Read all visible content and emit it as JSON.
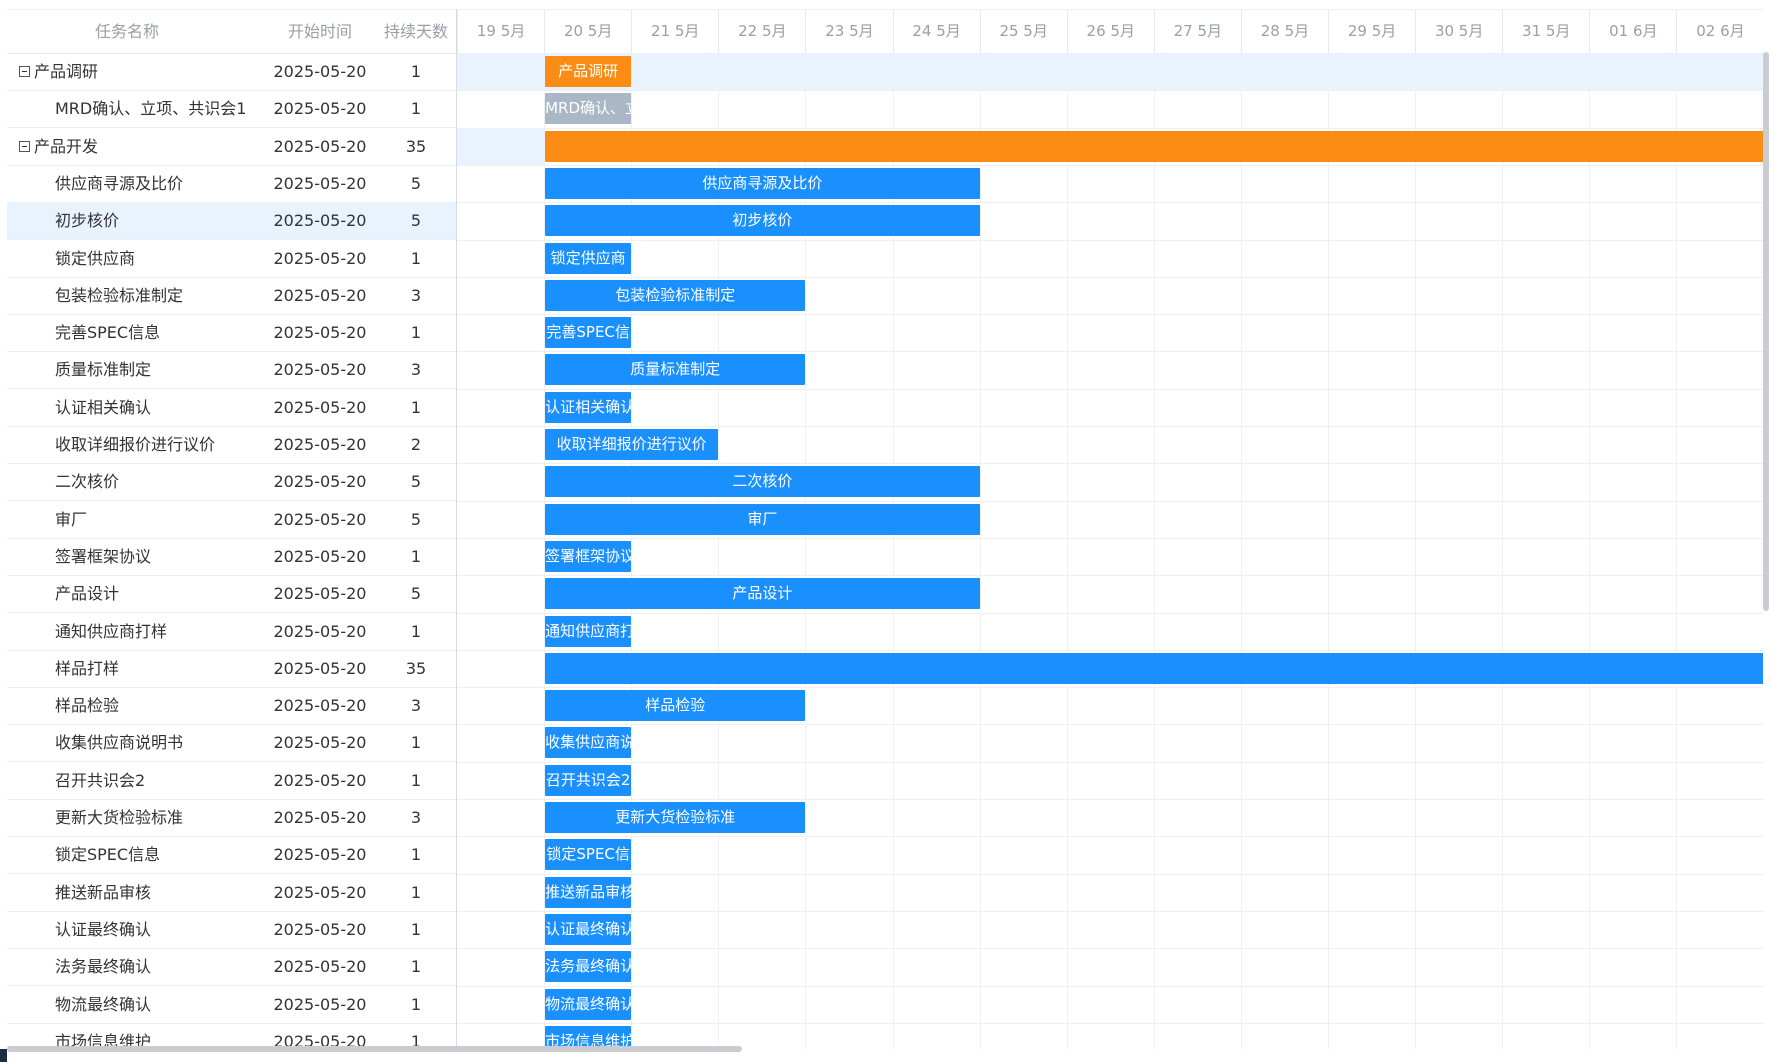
{
  "columns": {
    "name": "任务名称",
    "start": "开始时间",
    "duration": "持续天数"
  },
  "dates": [
    "19 5月",
    "20 5月",
    "21 5月",
    "22 5月",
    "23 5月",
    "24 5月",
    "25 5月",
    "26 5月",
    "27 5月",
    "28 5月",
    "29 5月",
    "30 5月",
    "31 5月",
    "01 6月",
    "02 6月"
  ],
  "colors": {
    "task": "#1a90ff",
    "project": "#fa8c16",
    "done": "#a9b7c6",
    "highlight": "#e8f3fe"
  },
  "tasks": [
    {
      "name": "产品调研",
      "start": "2025-05-20",
      "duration": "1",
      "type": "project",
      "bar_label": "产品调研"
    },
    {
      "name": "MRD确认、立项、共识会1",
      "start": "2025-05-20",
      "duration": "1",
      "type": "done",
      "bar_label": "MRD确认、立"
    },
    {
      "name": "产品开发",
      "start": "2025-05-20",
      "duration": "35",
      "type": "project",
      "bar_label": ""
    },
    {
      "name": "供应商寻源及比价",
      "start": "2025-05-20",
      "duration": "5",
      "type": "task",
      "bar_label": "供应商寻源及比价"
    },
    {
      "name": "初步核价",
      "start": "2025-05-20",
      "duration": "5",
      "type": "task",
      "bar_label": "初步核价"
    },
    {
      "name": "锁定供应商",
      "start": "2025-05-20",
      "duration": "1",
      "type": "task",
      "bar_label": "锁定供应商"
    },
    {
      "name": "包装检验标准制定",
      "start": "2025-05-20",
      "duration": "3",
      "type": "task",
      "bar_label": "包装检验标准制定"
    },
    {
      "name": "完善SPEC信息",
      "start": "2025-05-20",
      "duration": "1",
      "type": "task",
      "bar_label": "完善SPEC信"
    },
    {
      "name": "质量标准制定",
      "start": "2025-05-20",
      "duration": "3",
      "type": "task",
      "bar_label": "质量标准制定"
    },
    {
      "name": "认证相关确认",
      "start": "2025-05-20",
      "duration": "1",
      "type": "task",
      "bar_label": "认证相关确认"
    },
    {
      "name": "收取详细报价进行议价",
      "start": "2025-05-20",
      "duration": "2",
      "type": "task",
      "bar_label": "收取详细报价进行议价"
    },
    {
      "name": "二次核价",
      "start": "2025-05-20",
      "duration": "5",
      "type": "task",
      "bar_label": "二次核价"
    },
    {
      "name": "审厂",
      "start": "2025-05-20",
      "duration": "5",
      "type": "task",
      "bar_label": "审厂"
    },
    {
      "name": "签署框架协议",
      "start": "2025-05-20",
      "duration": "1",
      "type": "task",
      "bar_label": "签署框架协议"
    },
    {
      "name": "产品设计",
      "start": "2025-05-20",
      "duration": "5",
      "type": "task",
      "bar_label": "产品设计"
    },
    {
      "name": "通知供应商打样",
      "start": "2025-05-20",
      "duration": "1",
      "type": "task",
      "bar_label": "通知供应商打"
    },
    {
      "name": "样品打样",
      "start": "2025-05-20",
      "duration": "35",
      "type": "task",
      "bar_label": ""
    },
    {
      "name": "样品检验",
      "start": "2025-05-20",
      "duration": "3",
      "type": "task",
      "bar_label": "样品检验"
    },
    {
      "name": "收集供应商说明书",
      "start": "2025-05-20",
      "duration": "1",
      "type": "task",
      "bar_label": "收集供应商说"
    },
    {
      "name": "召开共识会2",
      "start": "2025-05-20",
      "duration": "1",
      "type": "task",
      "bar_label": "召开共识会2"
    },
    {
      "name": "更新大货检验标准",
      "start": "2025-05-20",
      "duration": "3",
      "type": "task",
      "bar_label": "更新大货检验标准"
    },
    {
      "name": "锁定SPEC信息",
      "start": "2025-05-20",
      "duration": "1",
      "type": "task",
      "bar_label": "锁定SPEC信"
    },
    {
      "name": "推送新品审核",
      "start": "2025-05-20",
      "duration": "1",
      "type": "task",
      "bar_label": "推送新品审核"
    },
    {
      "name": "认证最终确认",
      "start": "2025-05-20",
      "duration": "1",
      "type": "task",
      "bar_label": "认证最终确认"
    },
    {
      "name": "法务最终确认",
      "start": "2025-05-20",
      "duration": "1",
      "type": "task",
      "bar_label": "法务最终确认"
    },
    {
      "name": "物流最终确认",
      "start": "2025-05-20",
      "duration": "1",
      "type": "task",
      "bar_label": "物流最终确认"
    },
    {
      "name": "市场信息维护",
      "start": "2025-05-20",
      "duration": "1",
      "type": "task",
      "bar_label": "市场信息维护"
    }
  ]
}
